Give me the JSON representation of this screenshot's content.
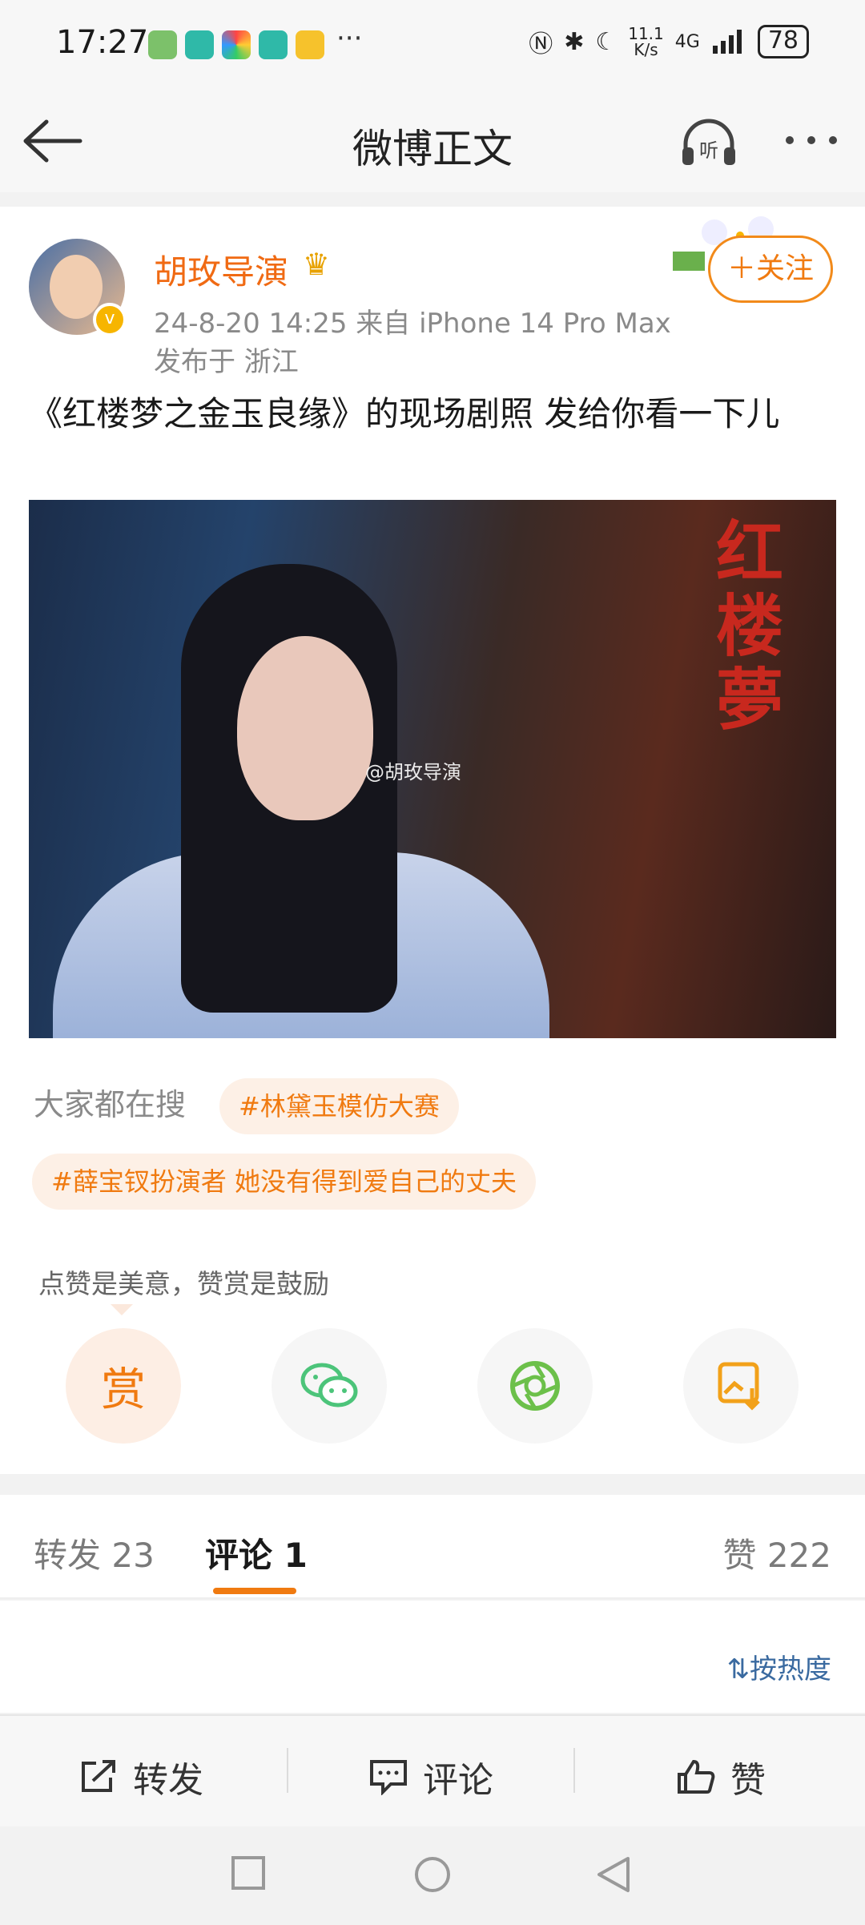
{
  "status_bar": {
    "time": "17:27",
    "more_dots": "···",
    "net_speed_top": "11.1",
    "net_speed_bottom": "K/s",
    "signal": "4G",
    "battery": "78"
  },
  "header": {
    "title": "微博正文"
  },
  "post": {
    "author": "胡玫导演",
    "time_device": "24-8-20 14:25  来自 iPhone 14 Pro Max",
    "location": "发布于 浙江",
    "follow_label": "＋关注",
    "content": "《红楼梦之金玉良缘》的现场剧照 发给你看一下儿",
    "image": {
      "title_text": "红楼夢",
      "watermark": "@胡玫导演"
    }
  },
  "trending": {
    "label": "大家都在搜",
    "tags": [
      "#林黛玉模仿大赛",
      "#薛宝钗扮演者 她没有得到爱自己的丈夫"
    ]
  },
  "share": {
    "tip": "点赞是美意，赞赏是鼓励",
    "reward_label": "赏"
  },
  "tabs": {
    "repost": "转发 23",
    "comments": "评论 1",
    "likes": "赞 222"
  },
  "sort_label": "按热度",
  "bottom_bar": {
    "repost": "转发",
    "comment": "评论",
    "like": "赞"
  },
  "colors": {
    "accent": "#f07a10",
    "link": "#3a6aa0"
  }
}
